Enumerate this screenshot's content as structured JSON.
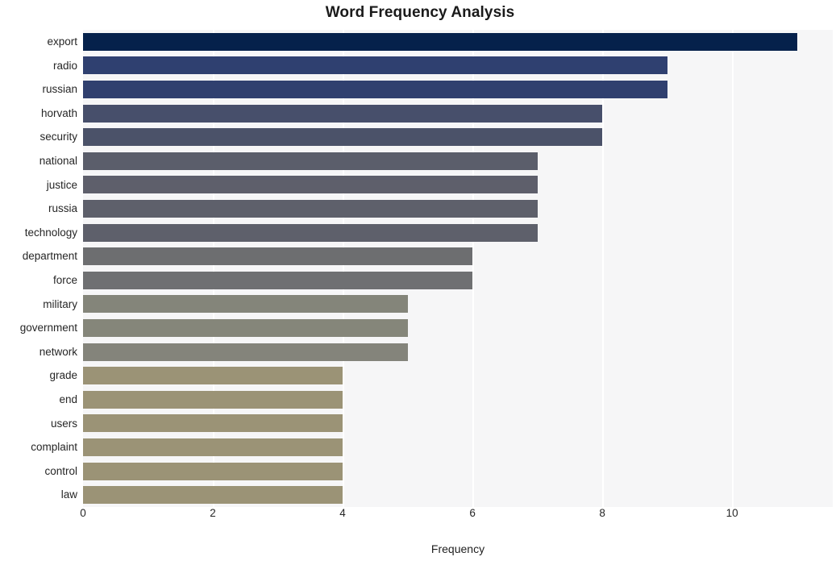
{
  "chart": {
    "title": "Word Frequency Analysis",
    "xlabel": "Frequency",
    "ylabel": ""
  },
  "chart_data": {
    "type": "bar",
    "orientation": "horizontal",
    "title": "Word Frequency Analysis",
    "xlabel": "Frequency",
    "ylabel": "",
    "xlim": [
      0,
      11.55
    ],
    "xticks": [
      0,
      2,
      4,
      6,
      8,
      10
    ],
    "xtick_labels": [
      "0",
      "2",
      "4",
      "6",
      "8",
      "10"
    ],
    "grid": "vertical-white",
    "legend": "none",
    "categories": [
      "export",
      "radio",
      "russian",
      "horvath",
      "security",
      "national",
      "justice",
      "russia",
      "technology",
      "department",
      "force",
      "military",
      "government",
      "network",
      "grade",
      "end",
      "users",
      "complaint",
      "control",
      "law"
    ],
    "values": [
      11,
      9,
      9,
      8,
      8,
      7,
      7,
      7,
      7,
      6,
      6,
      5,
      5,
      5,
      4,
      4,
      4,
      4,
      4,
      4
    ],
    "colors": [
      "#05214b",
      "#2f4070",
      "#30406f",
      "#474f6b",
      "#4b5269",
      "#5b5e6b",
      "#5e5f6b",
      "#5e606b",
      "#5e606b",
      "#6d6e70",
      "#6f7072",
      "#84857a",
      "#85867a",
      "#84847b",
      "#9b9376",
      "#9b9376",
      "#9b9376",
      "#9b9376",
      "#9b9376",
      "#9b9376"
    ],
    "plot_background": "#f6f6f7",
    "figure_background": "#ffffff"
  }
}
